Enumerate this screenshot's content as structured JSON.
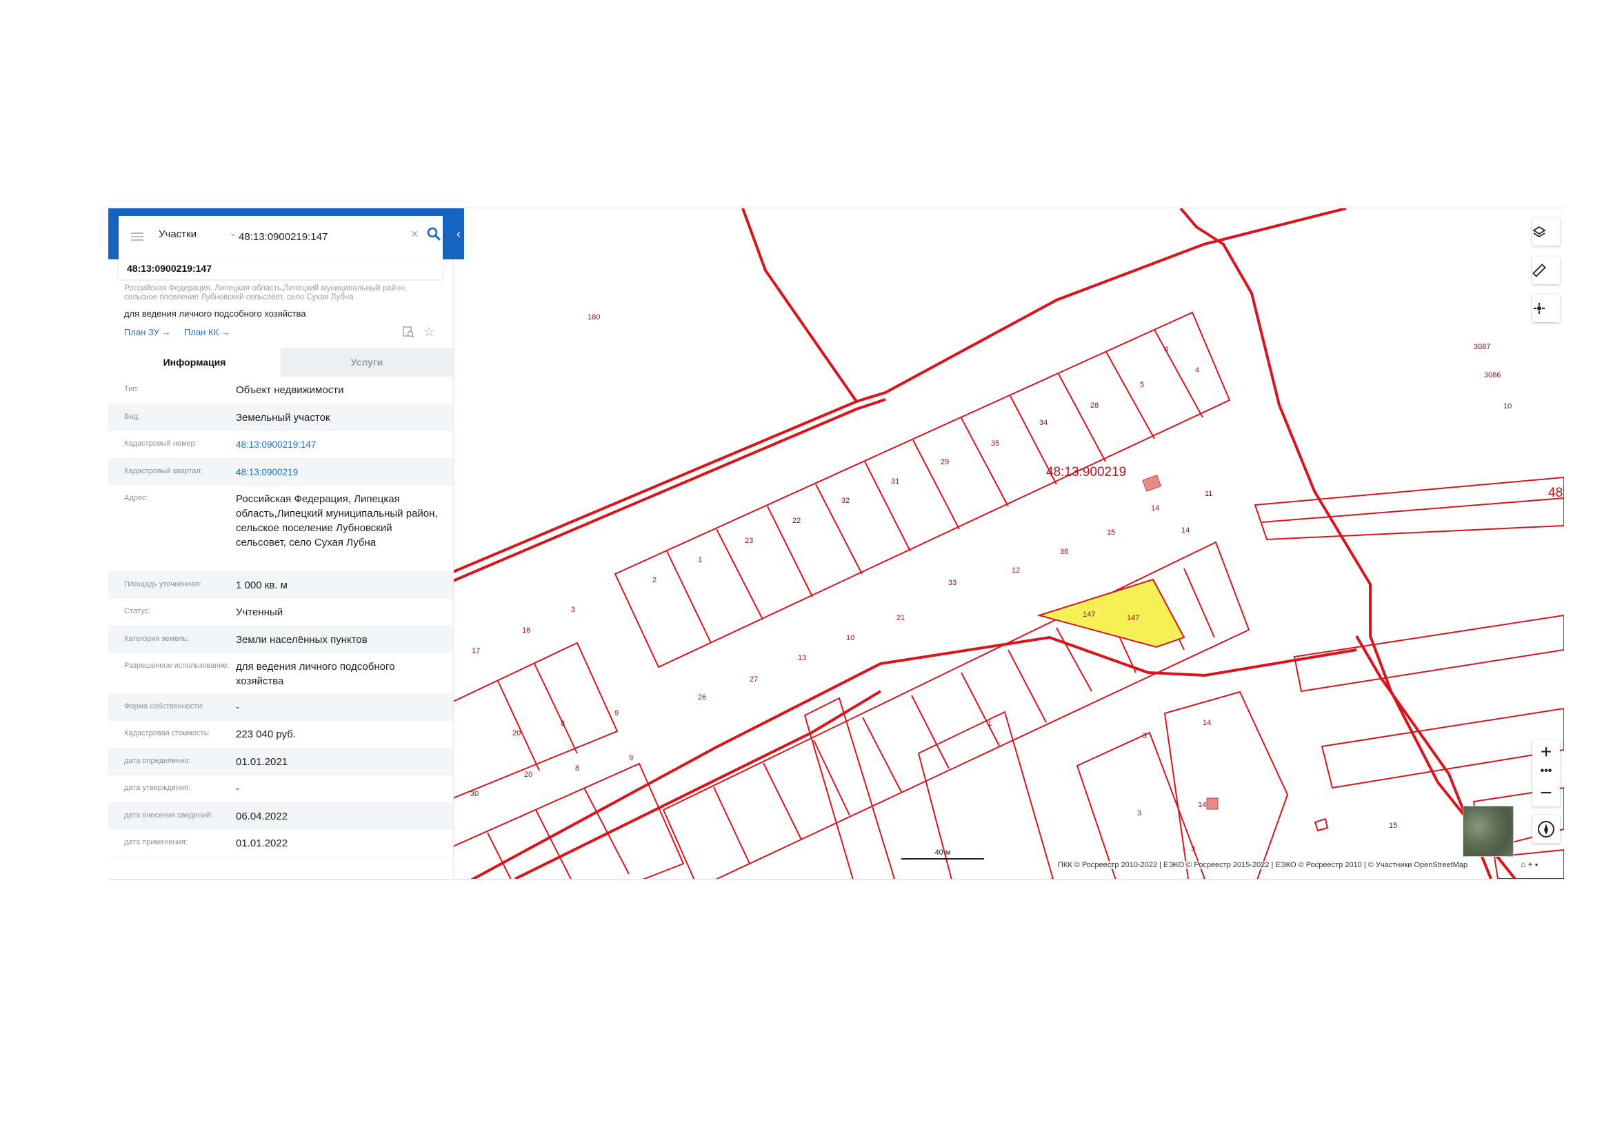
{
  "search": {
    "category": "Участки",
    "query": "48:13:0900219:147"
  },
  "result": {
    "title": "48:13:0900219:147",
    "address_small_line1": "Российская Федерация, Липецкая область,Липецкий муниципальный район,",
    "address_small_line2": "сельское поселение Лубновский сельсовет, село Сухая Лубна",
    "purpose": "для ведения личного подсобного хозяйства",
    "plan_zu_label": "План ЗУ",
    "plan_kk_label": "План КК"
  },
  "tabs": {
    "info": "Информация",
    "services": "Услуги"
  },
  "info_rows": [
    {
      "label": "Тип:",
      "value": "Объект недвижимости"
    },
    {
      "label": "Вид:",
      "value": "Земельный участок"
    },
    {
      "label": "Кадастровый номер:",
      "value": "48:13:0900219:147"
    },
    {
      "label": "Кадастровый квартал:",
      "value": "48:13:0900219"
    },
    {
      "label": "Адрес:",
      "value": "Российская Федерация, Липецкая область,Липецкий муниципальный район, сельское поселение Лубновский сельсовет, село Сухая Лубна"
    },
    {
      "label": "Площадь уточненная:",
      "value": "1 000 кв. м"
    },
    {
      "label": "Статус:",
      "value": "Учтенный"
    },
    {
      "label": "Категория земель:",
      "value": "Земли населённых пунктов"
    },
    {
      "label": "Разрешенное использование:",
      "value": "для ведения личного подсобного хозяйства"
    },
    {
      "label": "Форма собственности:",
      "value": "-"
    },
    {
      "label": "Кадастровая стоимость:",
      "value": "223 040 руб."
    },
    {
      "label": "дата определения:",
      "value": "01.01.2021"
    },
    {
      "label": "дата утверждения:",
      "value": "-"
    },
    {
      "label": "дата внесения сведений:",
      "value": "06.04.2022"
    },
    {
      "label": "дата применения:",
      "value": "01.01.2022"
    }
  ],
  "map": {
    "quarter_label": "48:13:900219",
    "quarter_label_edge": "48",
    "scale_label": "40 м",
    "attribution": "ПКК © Росреестр 2010-2022 | ЕЭКО © Росреестр 2015-2022 | ЕЭКО © Росреестр 2010 | © Участники OpenStreetMap",
    "parcel_labels": [
      "180",
      "3087",
      "3086",
      "10",
      "4",
      "4",
      "5",
      "28",
      "34",
      "35",
      "29",
      "31",
      "32",
      "22",
      "23",
      "1",
      "2",
      "14",
      "14",
      "11",
      "15",
      "36",
      "12",
      "33",
      "21",
      "10",
      "13",
      "27",
      "26",
      "17",
      "16",
      "3",
      "20",
      "20",
      "8",
      "8",
      "9",
      "9",
      "30",
      "1",
      "3",
      "14",
      "3",
      "14",
      "3",
      "15",
      "147",
      "147"
    ]
  },
  "colors": {
    "header_blue": "#1565c0",
    "link_blue": "#1f70c8",
    "parcel_red": "#d9141b",
    "selected_fill": "#f5f056"
  }
}
